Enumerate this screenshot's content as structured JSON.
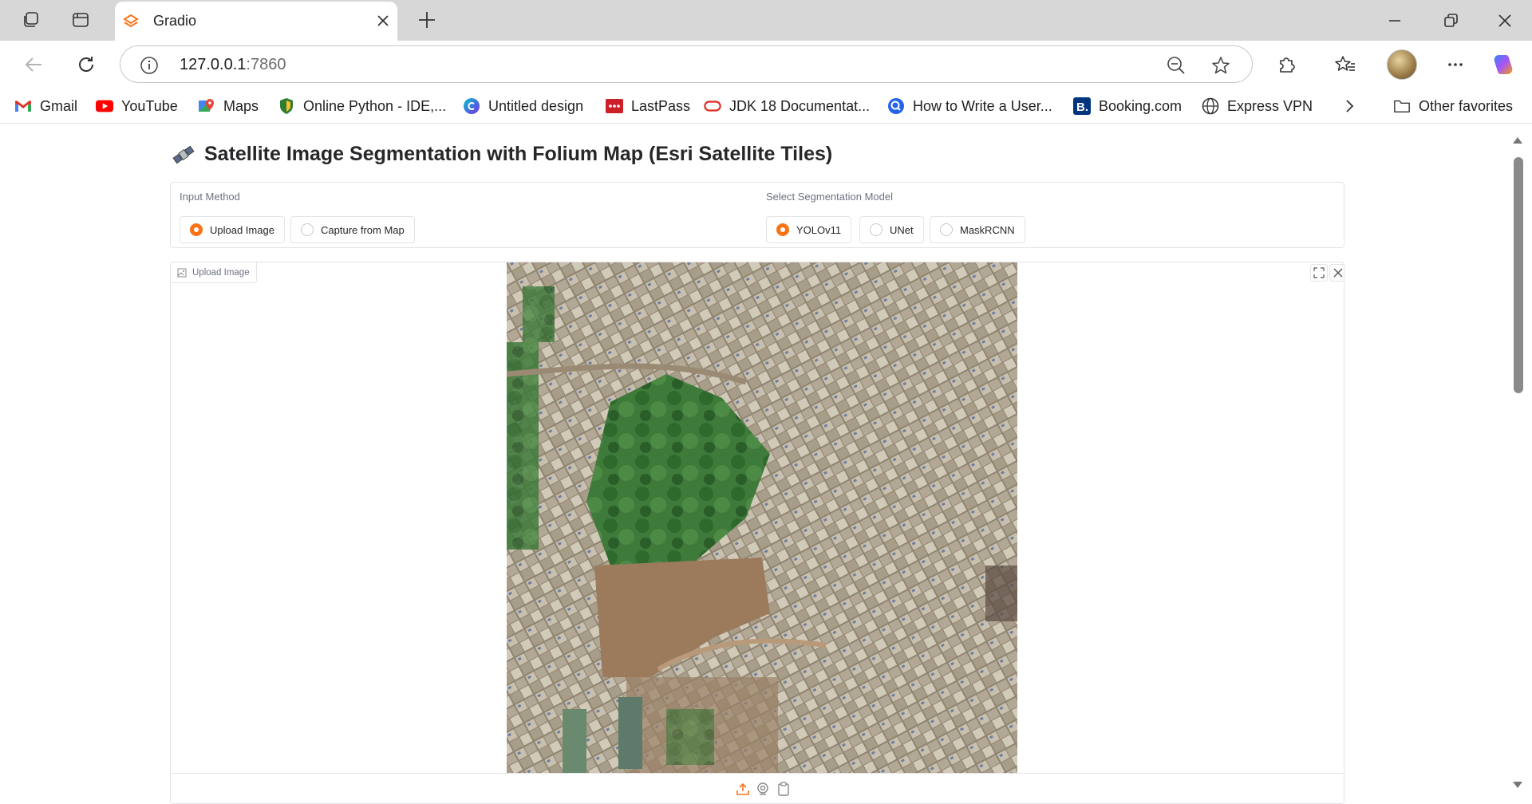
{
  "browser": {
    "tab": {
      "title": "Gradio"
    },
    "url": {
      "host": "127.0.0.1",
      "port": ":7860"
    },
    "bookmarks": [
      {
        "label": "Gmail",
        "icon": "gmail-icon"
      },
      {
        "label": "YouTube",
        "icon": "youtube-icon"
      },
      {
        "label": "Maps",
        "icon": "maps-icon"
      },
      {
        "label": "Online Python - IDE,...",
        "icon": "shield-icon"
      },
      {
        "label": "Untitled design",
        "icon": "canva-icon"
      },
      {
        "label": "LastPass",
        "icon": "lastpass-icon"
      },
      {
        "label": "JDK 18 Documentat...",
        "icon": "oracle-icon"
      },
      {
        "label": "How to Write a User...",
        "icon": "globe-search-icon"
      },
      {
        "label": "Booking.com",
        "icon": "booking-icon"
      },
      {
        "label": "Express VPN",
        "icon": "globe-icon"
      }
    ],
    "other_favorites": "Other favorites"
  },
  "app": {
    "title": "Satellite Image Segmentation with Folium Map (Esri Satellite Tiles)",
    "input_method": {
      "label": "Input Method",
      "options": [
        "Upload Image",
        "Capture from Map"
      ],
      "selected": "Upload Image"
    },
    "model": {
      "label": "Select Segmentation Model",
      "options": [
        "YOLOv11",
        "UNet",
        "MaskRCNN"
      ],
      "selected": "YOLOv11"
    },
    "image_panel": {
      "label": "Upload Image"
    }
  },
  "colors": {
    "accent": "#f97316",
    "tabstrip": "#d7d7d7"
  }
}
